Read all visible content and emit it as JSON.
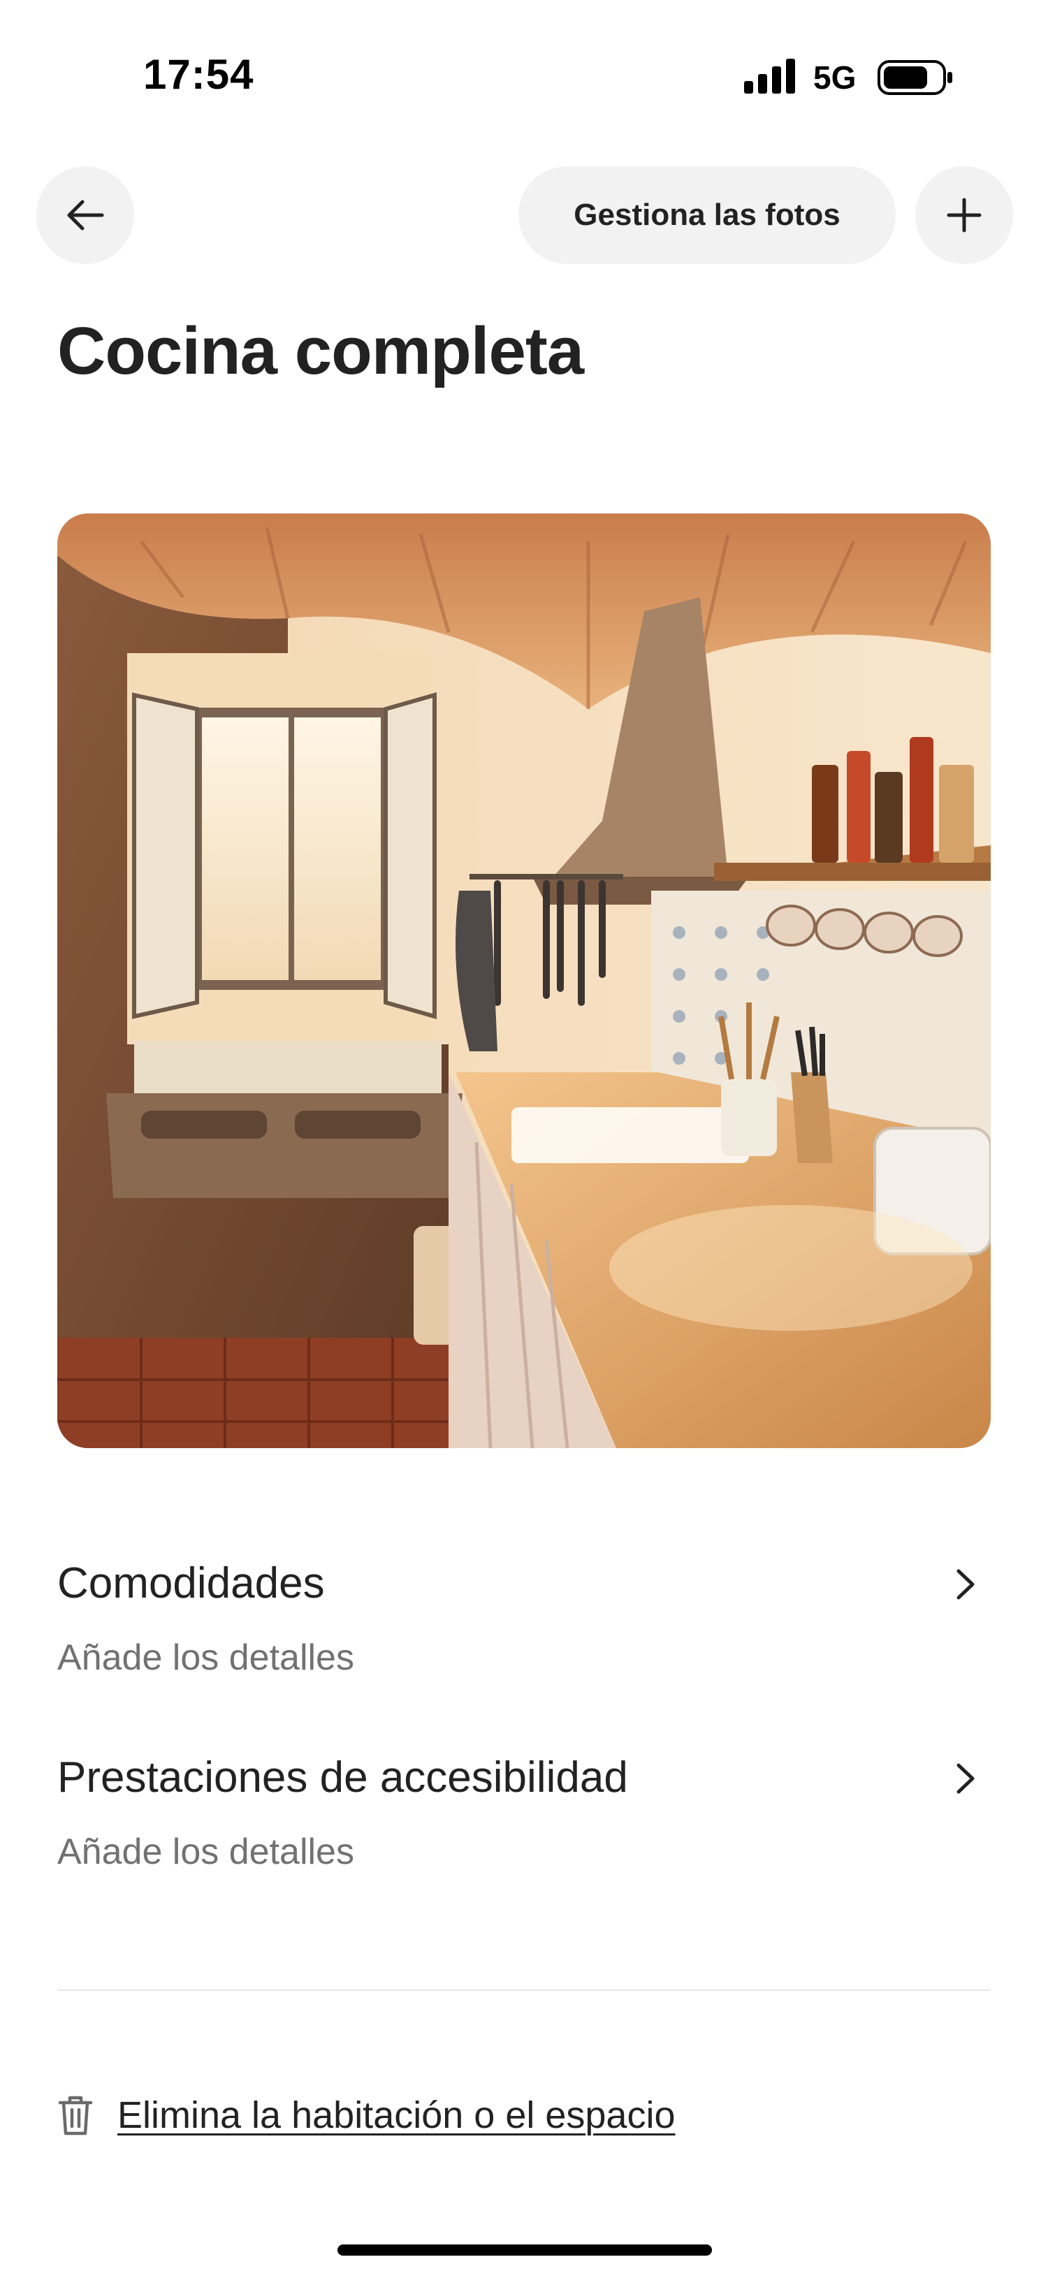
{
  "status_bar": {
    "time": "17:54",
    "network": "5G",
    "icons": [
      "signal-icon",
      "battery-icon"
    ]
  },
  "nav": {
    "back_icon": "arrow-left-icon",
    "manage_photos_label": "Gestiona las fotos",
    "add_icon": "plus-icon"
  },
  "page": {
    "title": "Cocina completa"
  },
  "photo": {
    "subject": "kitchen-photo"
  },
  "sections": [
    {
      "title": "Comodidades",
      "subtitle": "Añade los detalles",
      "icon": "chevron-right-icon"
    },
    {
      "title": "Prestaciones de accesibilidad",
      "subtitle": "Añade los detalles",
      "icon": "chevron-right-icon"
    }
  ],
  "delete": {
    "icon": "trash-icon",
    "label": "Elimina la habitación o el espacio"
  },
  "colors": {
    "background": "#ffffff",
    "text_primary": "#222222",
    "text_secondary": "#717171",
    "button_bg": "#f2f2f2",
    "divider": "#e6e6e6"
  }
}
